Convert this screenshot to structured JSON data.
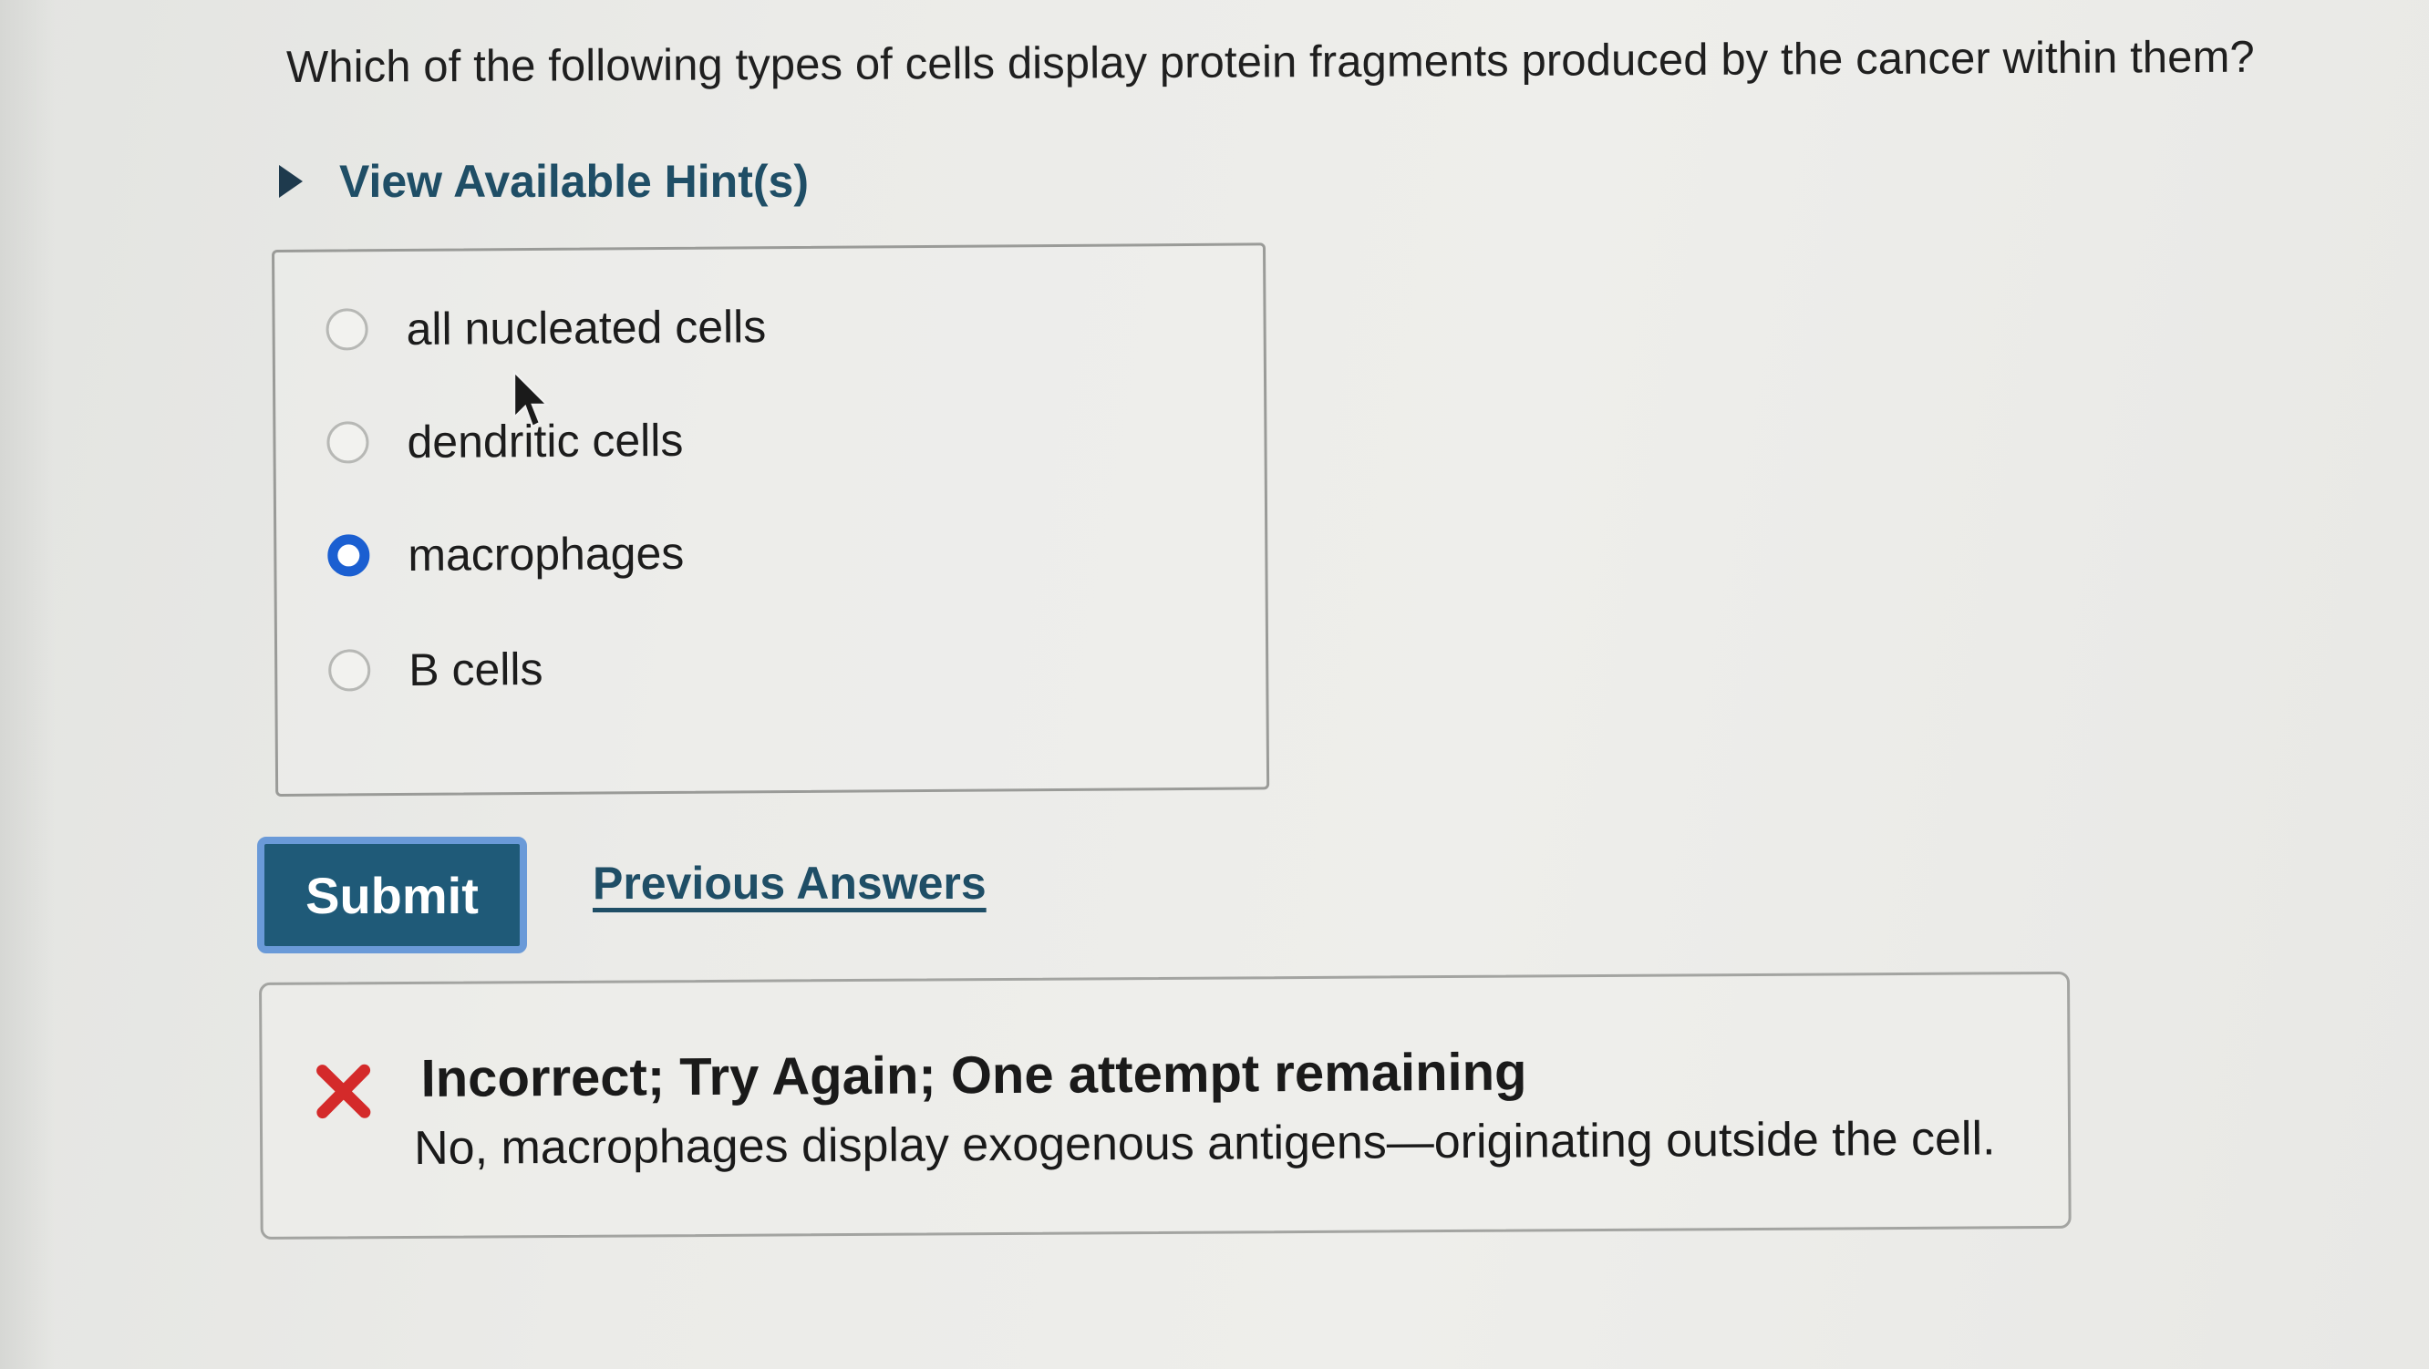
{
  "question": {
    "text": "Which of the following types of cells display protein fragments produced by the cancer within them?"
  },
  "hints": {
    "label": "View Available Hint(s)",
    "icon": "triangle-right-icon"
  },
  "options": [
    {
      "label": "all nucleated cells",
      "selected": false
    },
    {
      "label": "dendritic cells",
      "selected": false
    },
    {
      "label": "macrophages",
      "selected": true
    },
    {
      "label": "B cells",
      "selected": false
    }
  ],
  "actions": {
    "submit_label": "Submit",
    "previous_answers_label": "Previous Answers"
  },
  "feedback": {
    "icon": "x-mark-icon",
    "title": "Incorrect; Try Again; One attempt remaining",
    "message": "No, macrophages display exogenous antigens—originating outside the cell."
  },
  "colors": {
    "link": "#1f4e66",
    "submit_bg": "#1f5a78",
    "radio_selected": "#1b5fd1",
    "error": "#d42a2a"
  }
}
